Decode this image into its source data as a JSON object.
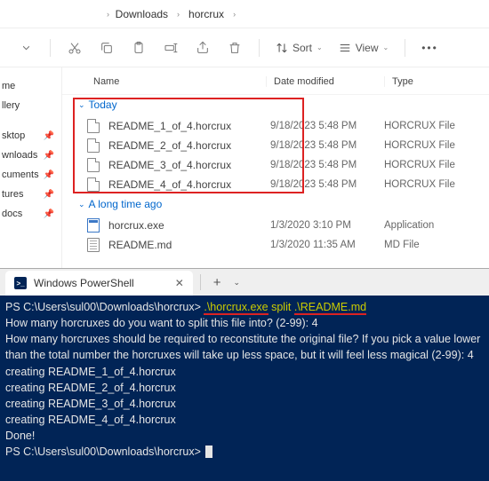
{
  "breadcrumb": {
    "parts": [
      "Downloads",
      "horcrux"
    ]
  },
  "toolbar": {
    "sort_label": "Sort",
    "view_label": "View"
  },
  "sidebar": {
    "items": [
      {
        "label": "me"
      },
      {
        "label": "llery"
      },
      {
        "label": "sktop"
      },
      {
        "label": "wnloads"
      },
      {
        "label": "cuments"
      },
      {
        "label": "tures"
      },
      {
        "label": "docs"
      }
    ]
  },
  "columns": {
    "name": "Name",
    "date": "Date modified",
    "type": "Type"
  },
  "groups": {
    "today": "Today",
    "longago": "A long time ago"
  },
  "files_today": [
    {
      "name": "README_1_of_4.horcrux",
      "date": "9/18/2023 5:48 PM",
      "type": "HORCRUX File"
    },
    {
      "name": "README_2_of_4.horcrux",
      "date": "9/18/2023 5:48 PM",
      "type": "HORCRUX File"
    },
    {
      "name": "README_3_of_4.horcrux",
      "date": "9/18/2023 5:48 PM",
      "type": "HORCRUX File"
    },
    {
      "name": "README_4_of_4.horcrux",
      "date": "9/18/2023 5:48 PM",
      "type": "HORCRUX File"
    }
  ],
  "files_old": [
    {
      "name": "horcrux.exe",
      "date": "1/3/2020 3:10 PM",
      "type": "Application",
      "icon": "exe"
    },
    {
      "name": "README.md",
      "date": "1/3/2020 11:35 AM",
      "type": "MD File",
      "icon": "md"
    }
  ],
  "terminal": {
    "tab_title": "Windows PowerShell",
    "prompt1": "PS C:\\Users\\sul00\\Downloads\\horcrux> ",
    "cmd_part1": ".\\horcrux.exe",
    "cmd_part2": " split ",
    "cmd_part3": ".\\README.md",
    "line2": "How many horcruxes do you want to split this file into? (2-99): 4",
    "line3": "How many horcruxes should be required to reconstitute the original file? If you pick a value lower than the total number the horcruxes will take up less space, but it will feel less magical (2-99): 4",
    "line4": "creating README_1_of_4.horcrux",
    "line5": "creating README_2_of_4.horcrux",
    "line6": "creating README_3_of_4.horcrux",
    "line7": "creating README_4_of_4.horcrux",
    "line8": "Done!",
    "prompt2": "PS C:\\Users\\sul00\\Downloads\\horcrux> "
  }
}
